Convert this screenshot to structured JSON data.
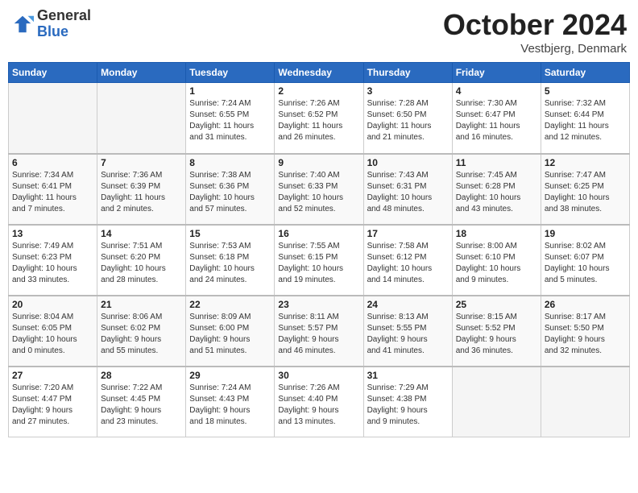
{
  "header": {
    "logo_general": "General",
    "logo_blue": "Blue",
    "month_year": "October 2024",
    "location": "Vestbjerg, Denmark"
  },
  "weekdays": [
    "Sunday",
    "Monday",
    "Tuesday",
    "Wednesday",
    "Thursday",
    "Friday",
    "Saturday"
  ],
  "weeks": [
    [
      {
        "num": "",
        "info": "",
        "empty": true
      },
      {
        "num": "",
        "info": "",
        "empty": true
      },
      {
        "num": "1",
        "info": "Sunrise: 7:24 AM\nSunset: 6:55 PM\nDaylight: 11 hours\nand 31 minutes."
      },
      {
        "num": "2",
        "info": "Sunrise: 7:26 AM\nSunset: 6:52 PM\nDaylight: 11 hours\nand 26 minutes."
      },
      {
        "num": "3",
        "info": "Sunrise: 7:28 AM\nSunset: 6:50 PM\nDaylight: 11 hours\nand 21 minutes."
      },
      {
        "num": "4",
        "info": "Sunrise: 7:30 AM\nSunset: 6:47 PM\nDaylight: 11 hours\nand 16 minutes."
      },
      {
        "num": "5",
        "info": "Sunrise: 7:32 AM\nSunset: 6:44 PM\nDaylight: 11 hours\nand 12 minutes."
      }
    ],
    [
      {
        "num": "6",
        "info": "Sunrise: 7:34 AM\nSunset: 6:41 PM\nDaylight: 11 hours\nand 7 minutes."
      },
      {
        "num": "7",
        "info": "Sunrise: 7:36 AM\nSunset: 6:39 PM\nDaylight: 11 hours\nand 2 minutes."
      },
      {
        "num": "8",
        "info": "Sunrise: 7:38 AM\nSunset: 6:36 PM\nDaylight: 10 hours\nand 57 minutes."
      },
      {
        "num": "9",
        "info": "Sunrise: 7:40 AM\nSunset: 6:33 PM\nDaylight: 10 hours\nand 52 minutes."
      },
      {
        "num": "10",
        "info": "Sunrise: 7:43 AM\nSunset: 6:31 PM\nDaylight: 10 hours\nand 48 minutes."
      },
      {
        "num": "11",
        "info": "Sunrise: 7:45 AM\nSunset: 6:28 PM\nDaylight: 10 hours\nand 43 minutes."
      },
      {
        "num": "12",
        "info": "Sunrise: 7:47 AM\nSunset: 6:25 PM\nDaylight: 10 hours\nand 38 minutes."
      }
    ],
    [
      {
        "num": "13",
        "info": "Sunrise: 7:49 AM\nSunset: 6:23 PM\nDaylight: 10 hours\nand 33 minutes."
      },
      {
        "num": "14",
        "info": "Sunrise: 7:51 AM\nSunset: 6:20 PM\nDaylight: 10 hours\nand 28 minutes."
      },
      {
        "num": "15",
        "info": "Sunrise: 7:53 AM\nSunset: 6:18 PM\nDaylight: 10 hours\nand 24 minutes."
      },
      {
        "num": "16",
        "info": "Sunrise: 7:55 AM\nSunset: 6:15 PM\nDaylight: 10 hours\nand 19 minutes."
      },
      {
        "num": "17",
        "info": "Sunrise: 7:58 AM\nSunset: 6:12 PM\nDaylight: 10 hours\nand 14 minutes."
      },
      {
        "num": "18",
        "info": "Sunrise: 8:00 AM\nSunset: 6:10 PM\nDaylight: 10 hours\nand 9 minutes."
      },
      {
        "num": "19",
        "info": "Sunrise: 8:02 AM\nSunset: 6:07 PM\nDaylight: 10 hours\nand 5 minutes."
      }
    ],
    [
      {
        "num": "20",
        "info": "Sunrise: 8:04 AM\nSunset: 6:05 PM\nDaylight: 10 hours\nand 0 minutes."
      },
      {
        "num": "21",
        "info": "Sunrise: 8:06 AM\nSunset: 6:02 PM\nDaylight: 9 hours\nand 55 minutes."
      },
      {
        "num": "22",
        "info": "Sunrise: 8:09 AM\nSunset: 6:00 PM\nDaylight: 9 hours\nand 51 minutes."
      },
      {
        "num": "23",
        "info": "Sunrise: 8:11 AM\nSunset: 5:57 PM\nDaylight: 9 hours\nand 46 minutes."
      },
      {
        "num": "24",
        "info": "Sunrise: 8:13 AM\nSunset: 5:55 PM\nDaylight: 9 hours\nand 41 minutes."
      },
      {
        "num": "25",
        "info": "Sunrise: 8:15 AM\nSunset: 5:52 PM\nDaylight: 9 hours\nand 36 minutes."
      },
      {
        "num": "26",
        "info": "Sunrise: 8:17 AM\nSunset: 5:50 PM\nDaylight: 9 hours\nand 32 minutes."
      }
    ],
    [
      {
        "num": "27",
        "info": "Sunrise: 7:20 AM\nSunset: 4:47 PM\nDaylight: 9 hours\nand 27 minutes."
      },
      {
        "num": "28",
        "info": "Sunrise: 7:22 AM\nSunset: 4:45 PM\nDaylight: 9 hours\nand 23 minutes."
      },
      {
        "num": "29",
        "info": "Sunrise: 7:24 AM\nSunset: 4:43 PM\nDaylight: 9 hours\nand 18 minutes."
      },
      {
        "num": "30",
        "info": "Sunrise: 7:26 AM\nSunset: 4:40 PM\nDaylight: 9 hours\nand 13 minutes."
      },
      {
        "num": "31",
        "info": "Sunrise: 7:29 AM\nSunset: 4:38 PM\nDaylight: 9 hours\nand 9 minutes."
      },
      {
        "num": "",
        "info": "",
        "empty": true
      },
      {
        "num": "",
        "info": "",
        "empty": true
      }
    ]
  ]
}
